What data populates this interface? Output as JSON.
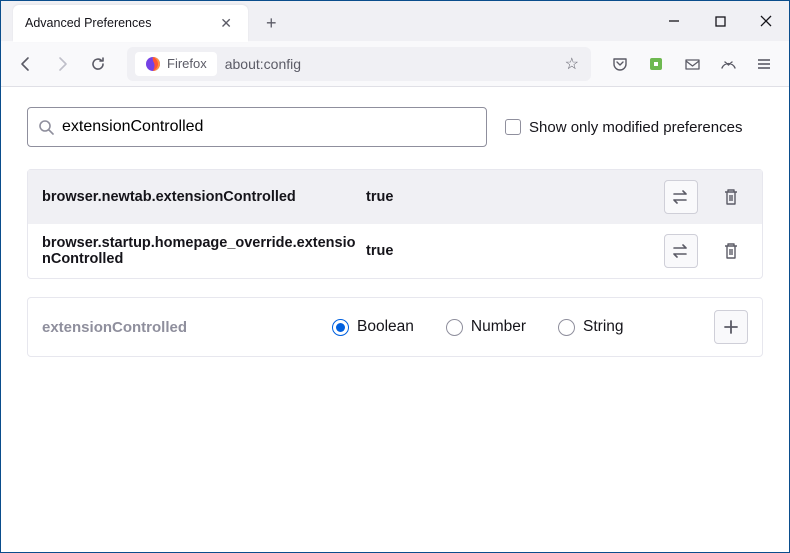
{
  "window": {
    "tab_title": "Advanced Preferences"
  },
  "toolbar": {
    "identity_label": "Firefox",
    "url": "about:config"
  },
  "search": {
    "value": "extensionControlled",
    "show_modified_label": "Show only modified preferences",
    "show_modified_checked": false
  },
  "prefs": [
    {
      "name": "browser.newtab.extensionControlled",
      "value": "true"
    },
    {
      "name": "browser.startup.homepage_override.extensionControlled",
      "value": "true"
    }
  ],
  "add_pref": {
    "name": "extensionControlled",
    "types": [
      "Boolean",
      "Number",
      "String"
    ],
    "selected": "Boolean"
  }
}
